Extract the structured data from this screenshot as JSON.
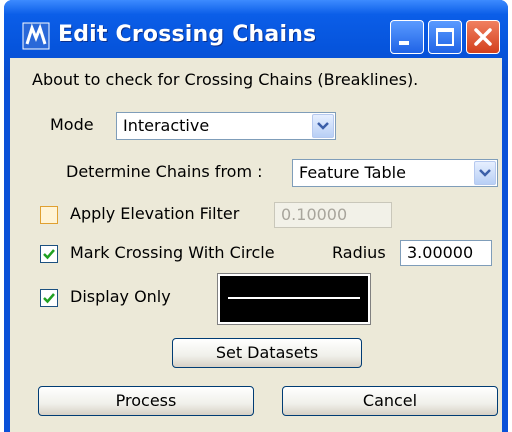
{
  "window": {
    "title": "Edit Crossing Chains"
  },
  "description": "About to check for Crossing Chains (Breaklines).",
  "mode": {
    "label": "Mode",
    "value": "Interactive"
  },
  "determine": {
    "label": "Determine Chains from :",
    "value": "Feature Table"
  },
  "elevation_filter": {
    "label": "Apply Elevation Filter",
    "checked": false,
    "value": "0.10000"
  },
  "mark_crossing": {
    "label": "Mark Crossing With Circle",
    "checked": true,
    "radius_label": "Radius",
    "radius_value": "3.00000"
  },
  "display_only": {
    "label": "Display Only",
    "checked": true
  },
  "buttons": {
    "set_datasets": "Set Datasets",
    "process": "Process",
    "cancel": "Cancel"
  },
  "colors": {
    "titlebar": "#0654dc",
    "client": "#ece9d8",
    "check": "#21a121",
    "swatch": "#000000"
  }
}
